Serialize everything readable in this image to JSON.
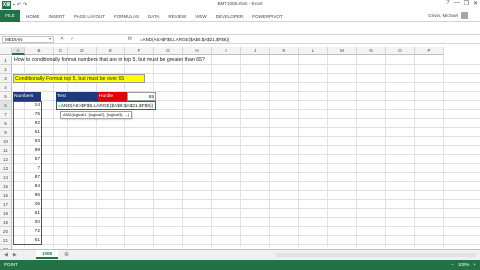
{
  "window": {
    "app_icon": "X≣",
    "title": "BMT1008.xlsm - Excel",
    "controls": [
      "?",
      "—",
      "❐",
      "✕"
    ]
  },
  "ribbon": {
    "file": "FILE",
    "tabs": [
      "HOME",
      "INSERT",
      "PAGE LAYOUT",
      "FORMULAS",
      "DATA",
      "REVIEW",
      "VIEW",
      "DEVELOPER",
      "POWERPIVOT"
    ],
    "user": "Girvin, Michael"
  },
  "formula_bar": {
    "name_box": "MEDIAN",
    "cancel": "✕",
    "enter": "✓",
    "fx": "fx",
    "formula": "=AND(A6>$F$5,LARGE($A$6:$A$21,$F$6))"
  },
  "columns": [
    "A",
    "B",
    "C",
    "D",
    "E",
    "F",
    "G",
    "H",
    "I",
    "J",
    "K",
    "L",
    "M",
    "N",
    "O",
    "P"
  ],
  "rows": [
    "1",
    "2",
    "3",
    "4",
    "5",
    "6",
    "7",
    "8",
    "9",
    "10",
    "11",
    "12",
    "13",
    "14",
    "15",
    "16",
    "17",
    "18",
    "19",
    "20",
    "21",
    "22"
  ],
  "sheet": {
    "title_text": "How to conditionally format numbers that are in top 5, but must be greater than 65?",
    "banner_text": "Conditionally Format top 5, but must be over 65",
    "numbers_header": "Numbers",
    "test_header": "Test",
    "hurdle_header": "Hurdle",
    "hurdle_value": "65",
    "numbers": [
      "14",
      "75",
      "92",
      "51",
      "63",
      "99",
      "57",
      "7",
      "87",
      "94",
      "96",
      "46",
      "61",
      "20",
      "72",
      "61"
    ],
    "edit_formula": "=AND(A6>$F$5,LARGE($A$6:$A$21,$F$6))",
    "tooltip": "AND(logical1, [logical2], [logical3], ...)"
  },
  "bottom": {
    "nav": [
      "◀",
      "▶"
    ],
    "sheet_tab": "1008",
    "add_sheet": "⊕",
    "status": "POINT",
    "zoom": "100%"
  }
}
